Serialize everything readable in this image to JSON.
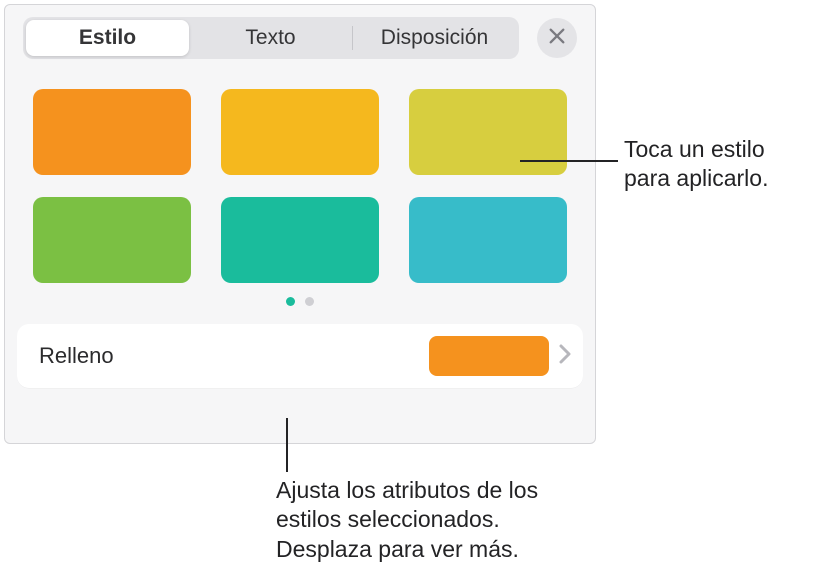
{
  "tabs": {
    "style": "Estilo",
    "text": "Texto",
    "layout": "Disposición"
  },
  "swatches": {
    "colors": [
      "#f5921e",
      "#f5b81e",
      "#d7ce3f",
      "#7bc043",
      "#1abc9c",
      "#37bcc9"
    ]
  },
  "pager": {
    "active_color": "#1abc9c",
    "inactive_color": "#cfcfd3"
  },
  "fill": {
    "label": "Relleno",
    "color": "#f5921e"
  },
  "callouts": {
    "apply": "Toca un estilo para aplicarlo.",
    "adjust": "Ajusta los atributos de los estilos seleccionados. Desplaza para ver más."
  }
}
